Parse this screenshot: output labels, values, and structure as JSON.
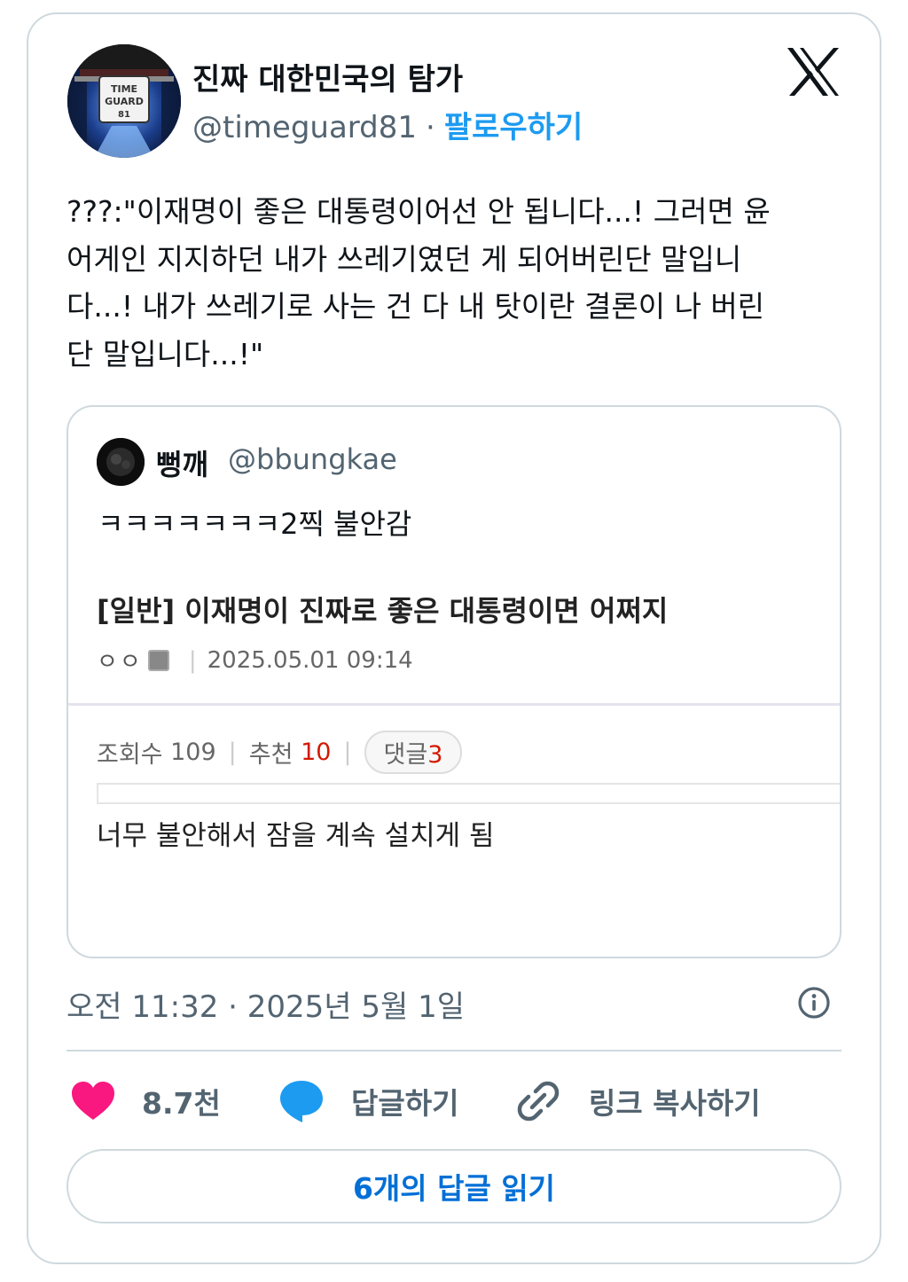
{
  "tweet": {
    "display_name": "진짜 대한민국의 탐가",
    "handle": "@timeguard81",
    "separator": "·",
    "follow_label": "팔로우하기",
    "avatar_text": [
      "TIME",
      "GUARD",
      "81"
    ],
    "text": "???:\"이재명이 좋은 대통령이어선 안 됩니다...! 그러면 윤\n어게인 지지하던 내가 쓰레기였던 게 되어버린단 말입니\n다...! 내가 쓰레기로 사는 건 다 내 탓이란 결론이 나 버린\n단 말입니다...!\"",
    "timestamp": "오전 11:32 · 2025년 5월 1일",
    "platform_icon": "x-logo-icon"
  },
  "quote": {
    "display_name": "뻥깨",
    "handle": "@bbungkae",
    "text": "ㅋㅋㅋㅋㅋㅋㅋ2찍 불안감",
    "capture": {
      "title": "[일반] 이재명이 진짜로 좋은 대통령이면 어쩌지",
      "author": "ㅇㅇ",
      "date": "2025.05.01 09:14",
      "views_label": "조회수",
      "views": "109",
      "recommend_label": "추천",
      "recommend": "10",
      "comments_label": "댓글",
      "comments": "3",
      "comment": "너무 불안해서 잠을 계속 설치게 됨"
    }
  },
  "actions": {
    "like_count": "8.7천",
    "reply_label": "답글하기",
    "copy_link_label": "링크 복사하기",
    "read_replies_label": "6개의 답글 읽기"
  },
  "colors": {
    "accent": "#1d9bf0",
    "like": "#f91880",
    "read_button_text": "#006fd6",
    "secondary_text": "#536471",
    "border": "#cfd9de",
    "recommend_red": "#d31900"
  }
}
